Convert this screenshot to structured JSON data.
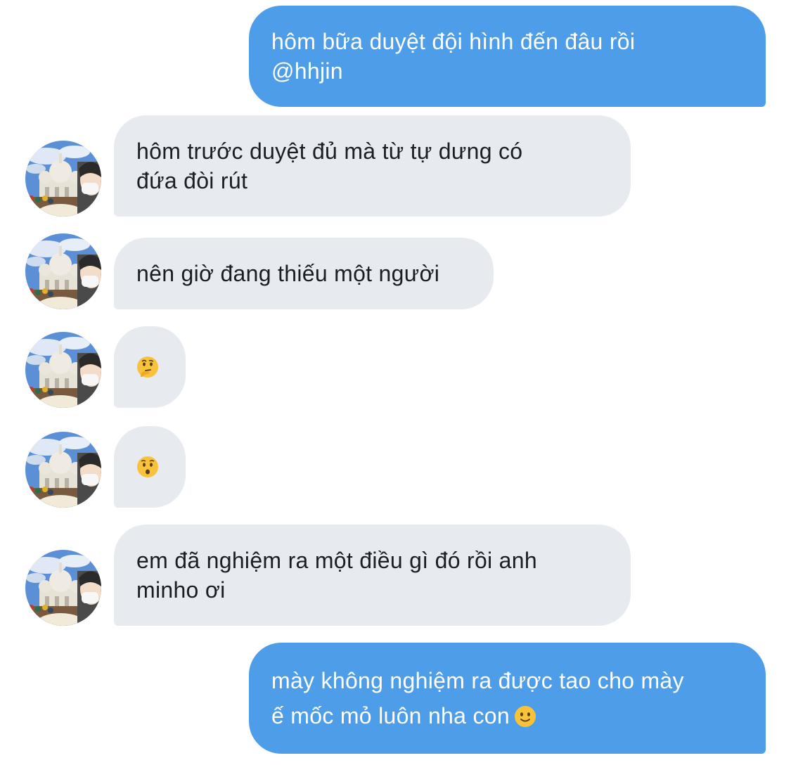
{
  "messages": [
    {
      "id": 1,
      "direction": "outgoing",
      "lines": [
        "hôm bữa duyệt đội hình đến đâu rồi",
        "@hhjin"
      ]
    },
    {
      "id": 2,
      "direction": "incoming",
      "lines": [
        "hôm trước duyệt đủ mà từ tự dưng có",
        "đứa đòi rút"
      ]
    },
    {
      "id": 3,
      "direction": "incoming",
      "lines": [
        "nên giờ đang thiếu một người"
      ]
    },
    {
      "id": 4,
      "direction": "incoming",
      "emoji": "thinking-face-emoji"
    },
    {
      "id": 5,
      "direction": "incoming",
      "emoji": "hushed-face-emoji"
    },
    {
      "id": 6,
      "direction": "incoming",
      "lines": [
        "em đã nghiệm ra một điều gì đó rồi anh",
        "minho ơi"
      ]
    },
    {
      "id": 7,
      "direction": "outgoing",
      "lines": [
        "mày không nghiệm ra được tao cho mày",
        "ế mốc mỏ luôn nha con"
      ],
      "trailing_emoji": "slightly-smiling-face-emoji"
    }
  ],
  "colors": {
    "outgoing_bubble": "#4d9de8",
    "incoming_bubble": "#e7eaef",
    "outgoing_text": "#ffffff",
    "incoming_text": "#1b1f24"
  }
}
